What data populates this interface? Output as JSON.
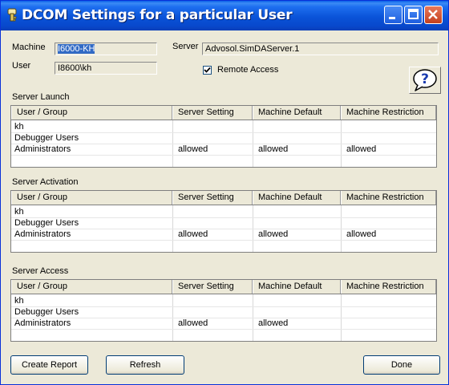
{
  "window": {
    "title": "DCOM Settings for a particular User"
  },
  "fields": {
    "machine_label": "Machine",
    "machine_value": "I6000-KH",
    "user_label": "User",
    "user_value": "I8600\\kh",
    "server_label": "Server",
    "server_value": "Advosol.SimDAServer.1",
    "remote_access_label": "Remote Access",
    "remote_access_checked": true
  },
  "columns": [
    "User / Group",
    "Server Setting",
    "Machine Default",
    "Machine Restriction"
  ],
  "sections": [
    {
      "title": "Server Launch",
      "rows": [
        [
          "kh",
          "",
          "",
          ""
        ],
        [
          "Debugger Users",
          "",
          "",
          ""
        ],
        [
          "Administrators",
          "allowed",
          "allowed",
          "allowed"
        ]
      ]
    },
    {
      "title": "Server Activation",
      "rows": [
        [
          "kh",
          "",
          "",
          ""
        ],
        [
          "Debugger Users",
          "",
          "",
          ""
        ],
        [
          "Administrators",
          "allowed",
          "allowed",
          "allowed"
        ]
      ]
    },
    {
      "title": "Server Access",
      "rows": [
        [
          "kh",
          "",
          "",
          ""
        ],
        [
          "Debugger Users",
          "",
          "",
          ""
        ],
        [
          "Administrators",
          "allowed",
          "allowed",
          ""
        ]
      ]
    }
  ],
  "buttons": {
    "create_report": "Create Report",
    "refresh": "Refresh",
    "done": "Done"
  },
  "help": {
    "icon": "help-question-icon"
  },
  "colors": {
    "titlebar": "#0a53d8",
    "face": "#ece9d8",
    "selection": "#316ac5"
  }
}
